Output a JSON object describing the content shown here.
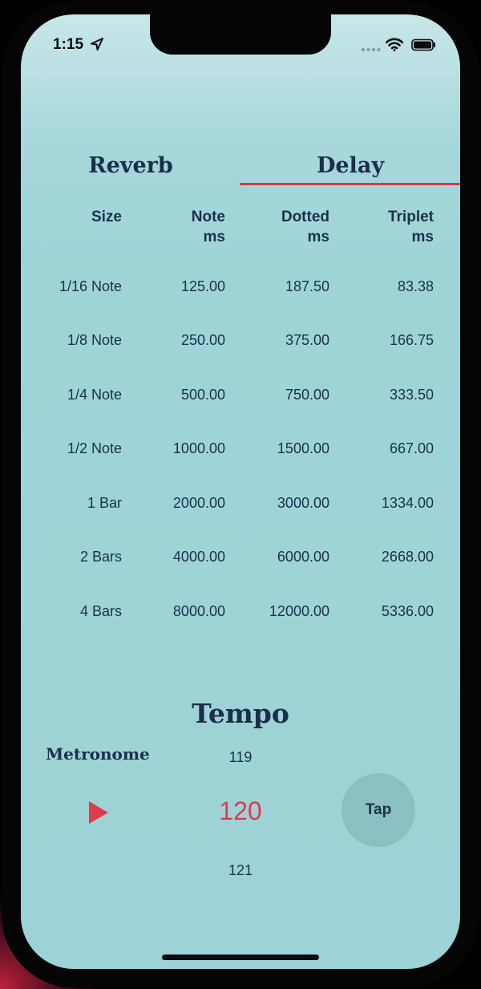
{
  "status_bar": {
    "time": "1:15",
    "icons": [
      "location-arrow-icon",
      "signal-dots-icon",
      "wifi-icon",
      "battery-icon"
    ]
  },
  "tabs": [
    {
      "label": "Reverb",
      "selected": false
    },
    {
      "label": "Delay",
      "selected": true
    }
  ],
  "table": {
    "headers": [
      [
        "Size"
      ],
      [
        "Note",
        "ms"
      ],
      [
        "Dotted",
        "ms"
      ],
      [
        "Triplet",
        "ms"
      ]
    ],
    "rows": [
      [
        "1/16 Note",
        "125.00",
        "187.50",
        "83.38"
      ],
      [
        "1/8 Note",
        "250.00",
        "375.00",
        "166.75"
      ],
      [
        "1/4 Note",
        "500.00",
        "750.00",
        "333.50"
      ],
      [
        "1/2 Note",
        "1000.00",
        "1500.00",
        "667.00"
      ],
      [
        "1 Bar",
        "2000.00",
        "3000.00",
        "1334.00"
      ],
      [
        "2 Bars",
        "4000.00",
        "6000.00",
        "2668.00"
      ],
      [
        "4 Bars",
        "8000.00",
        "12000.00",
        "5336.00"
      ]
    ]
  },
  "tempo": {
    "title": "Tempo",
    "metronome_label": "Metronome",
    "previous": "119",
    "current": "120",
    "next": "121",
    "tap_label": "Tap"
  },
  "colors": {
    "accent": "#e23a4c",
    "text": "#1b2f4d",
    "background": "#9dd3d6",
    "tap_button": "#8bbfc1"
  }
}
